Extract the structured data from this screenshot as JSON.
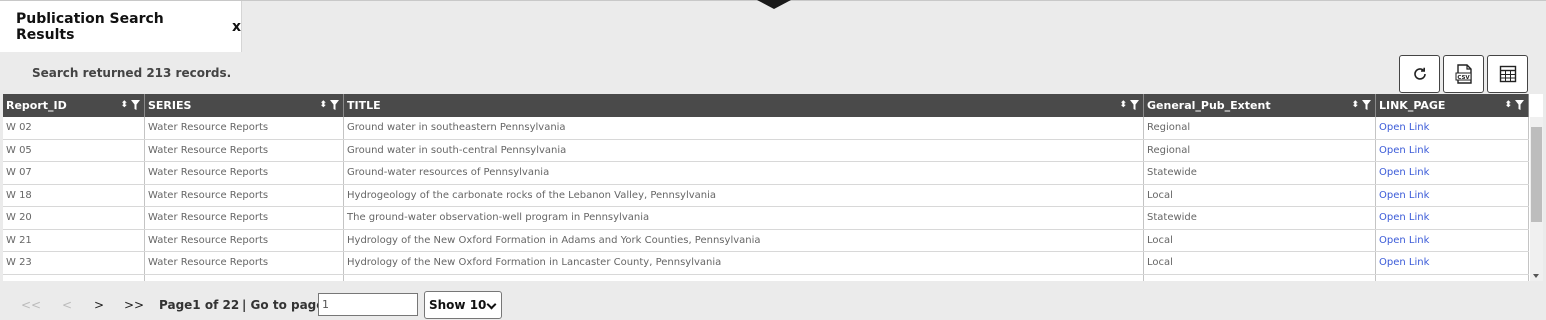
{
  "tab": {
    "title": "Publication Search Results",
    "close_label": "x"
  },
  "status_text": "Search returned 213 records.",
  "toolbar": {
    "refresh_icon": "refresh-icon",
    "csv_icon": "csv-export-icon",
    "table_icon": "table-columns-icon"
  },
  "table": {
    "columns": [
      "Report_ID",
      "SERIES",
      "TITLE",
      "General_Pub_Extent",
      "LINK_PAGE"
    ],
    "rows": [
      [
        "W 02",
        "Water Resource Reports",
        "Ground water in southeastern Pennsylvania",
        "Regional",
        "Open Link"
      ],
      [
        "W 05",
        "Water Resource Reports",
        "Ground water in south-central Pennsylvania",
        "Regional",
        "Open Link"
      ],
      [
        "W 07",
        "Water Resource Reports",
        "Ground-water resources of Pennsylvania",
        "Statewide",
        "Open Link"
      ],
      [
        "W 18",
        "Water Resource Reports",
        "Hydrogeology of the carbonate rocks of the Lebanon Valley, Pennsylvania",
        "Local",
        "Open Link"
      ],
      [
        "W 20",
        "Water Resource Reports",
        "The ground-water observation-well program in Pennsylvania",
        "Statewide",
        "Open Link"
      ],
      [
        "W 21",
        "Water Resource Reports",
        "Hydrology of the New Oxford Formation in Adams and York Counties, Pennsylvania",
        "Local",
        "Open Link"
      ],
      [
        "W 23",
        "Water Resource Reports",
        "Hydrology of the New Oxford Formation in Lancaster County, Pennsylvania",
        "Local",
        "Open Link"
      ]
    ]
  },
  "pager": {
    "first": "<<",
    "prev": "<",
    "next": ">",
    "last": ">>",
    "page_info": "Page1 of 22",
    "goto_label": "| Go to page:",
    "goto_value": "1",
    "show_value": "Show 10"
  },
  "colors": {
    "header_bg": "#4a4a4a",
    "link": "#3b5bd8",
    "background": "#ebebeb"
  }
}
